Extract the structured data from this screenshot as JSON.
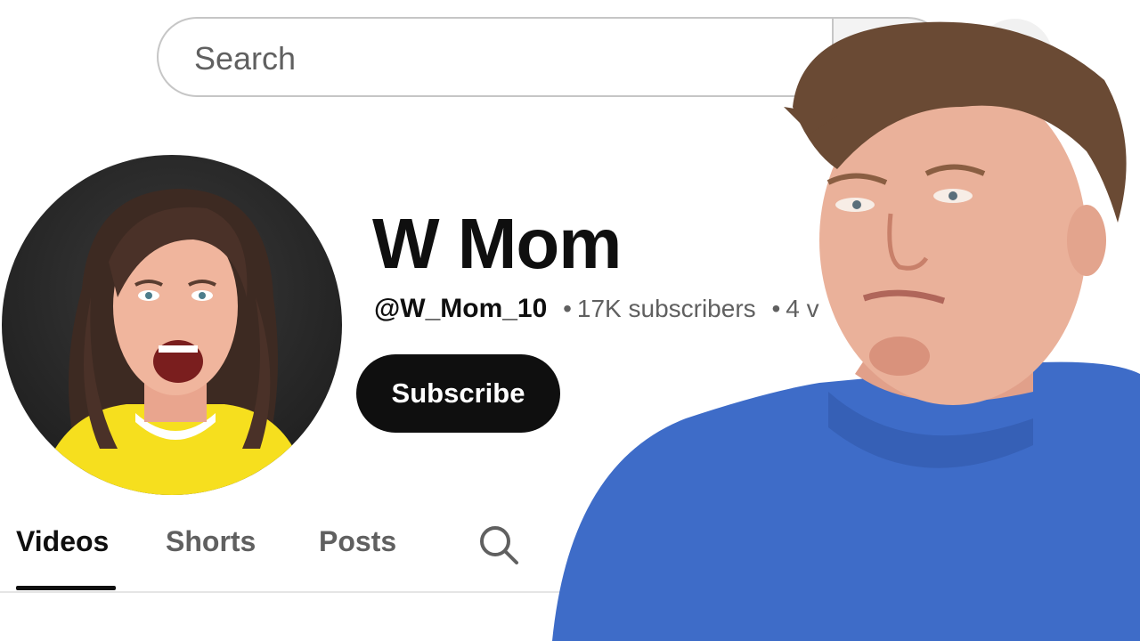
{
  "search": {
    "placeholder": "Search"
  },
  "channel": {
    "name": "W Mom",
    "handle": "@W_Mom_10",
    "subscribers": "17K subscribers",
    "videos": "4 videos",
    "subscribe_label": "Subscribe"
  },
  "tabs": [
    {
      "label": "Videos",
      "active": true
    },
    {
      "label": "Shorts",
      "active": false
    },
    {
      "label": "Posts",
      "active": false
    }
  ],
  "colors": {
    "subscribe_bg": "#0f0f0f",
    "avatar_shirt": "#f6df1e",
    "presenter_shirt": "#3e6cc8"
  },
  "icons": {
    "search_tab": "search-icon",
    "mic": "microphone-icon"
  }
}
